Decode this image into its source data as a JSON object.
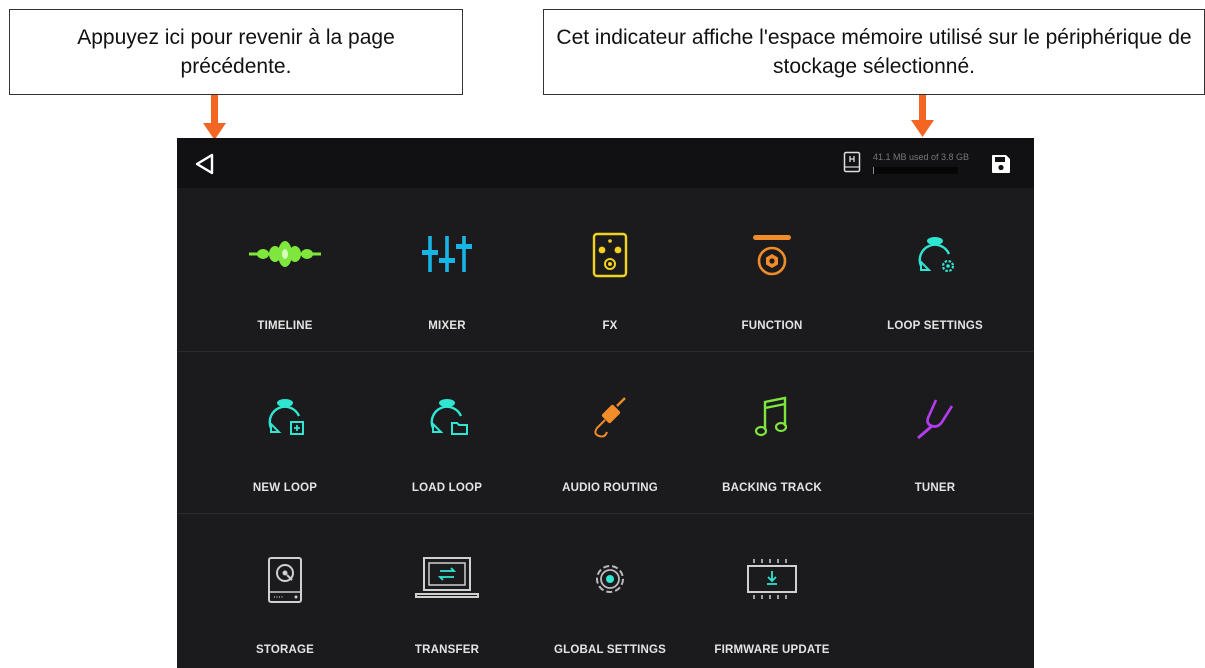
{
  "callouts": {
    "back": "Appuyez ici pour revenir à la page précédente.",
    "storage": "Cet indicateur affiche l'espace mémoire utilisé sur le périphérique de stockage sélectionné."
  },
  "colors": {
    "arrow": "#f26522",
    "accent_green": "#7fe63c",
    "accent_blue": "#19b4e6",
    "accent_yellow": "#f2d21e",
    "accent_orange": "#f28c28",
    "accent_teal": "#2ee6d2",
    "accent_purple": "#b43cf0"
  },
  "topbar": {
    "storage_text": "41.1 MB used of 3.8 GB",
    "storage_used_fraction": 0.011
  },
  "menu": {
    "timeline": "TIMELINE",
    "mixer": "MIXER",
    "fx": "FX",
    "function": "FUNCTION",
    "loop_settings": "LOOP SETTINGS",
    "new_loop": "NEW LOOP",
    "load_loop": "LOAD LOOP",
    "audio_routing": "AUDIO ROUTING",
    "backing_track": "BACKING TRACK",
    "tuner": "TUNER",
    "storage": "STORAGE",
    "transfer": "TRANSFER",
    "global_settings": "GLOBAL SETTINGS",
    "firmware_update": "FIRMWARE UPDATE"
  }
}
